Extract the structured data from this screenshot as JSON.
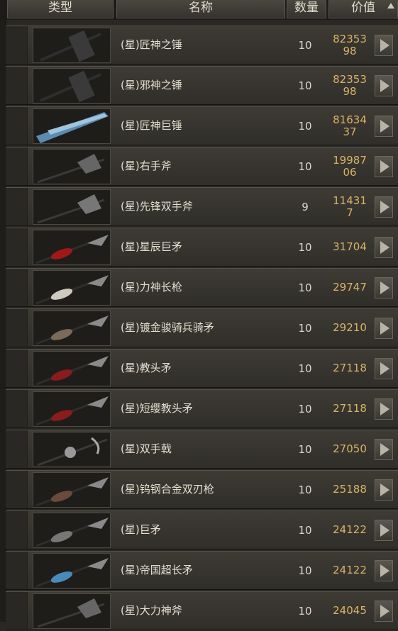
{
  "header": {
    "type_label": "类型",
    "name_label": "名称",
    "qty_label": "数量",
    "value_label": "价值",
    "sort_icon": "triangle-up-icon"
  },
  "colors": {
    "value_text": "#d9b46a",
    "row_bg": "#3a3731"
  },
  "items": [
    {
      "name": "(星)匠神之锤",
      "qty": "10",
      "value_line1": "82353",
      "value_line2": "98",
      "icon": "hammer",
      "accent": "#555"
    },
    {
      "name": "(星)邪神之锤",
      "qty": "10",
      "value_line1": "82353",
      "value_line2": "98",
      "icon": "hammer",
      "accent": "#555"
    },
    {
      "name": "(星)匠神巨锤",
      "qty": "10",
      "value_line1": "81634",
      "value_line2": "37",
      "icon": "blade",
      "accent": "#5a8bb0"
    },
    {
      "name": "(星)右手斧",
      "qty": "10",
      "value_line1": "19987",
      "value_line2": "06",
      "icon": "axe",
      "accent": "#666"
    },
    {
      "name": "(星)先锋双手斧",
      "qty": "9",
      "value_line1": "11431",
      "value_line2": "7",
      "icon": "axe",
      "accent": "#777"
    },
    {
      "name": "(星)星辰巨矛",
      "qty": "10",
      "value_line1": "31704",
      "value_line2": "",
      "icon": "spear",
      "accent": "#a01818"
    },
    {
      "name": "(星)力神长枪",
      "qty": "10",
      "value_line1": "29747",
      "value_line2": "",
      "icon": "spear",
      "accent": "#cfcac0"
    },
    {
      "name": "(星)镀金骏骑兵骑矛",
      "qty": "10",
      "value_line1": "29210",
      "value_line2": "",
      "icon": "spear",
      "accent": "#7a6a5a"
    },
    {
      "name": "(星)教头矛",
      "qty": "10",
      "value_line1": "27118",
      "value_line2": "",
      "icon": "spear",
      "accent": "#8a1c1c"
    },
    {
      "name": "(星)短缨教头矛",
      "qty": "10",
      "value_line1": "27118",
      "value_line2": "",
      "icon": "spear",
      "accent": "#8a1c1c"
    },
    {
      "name": "(星)双手戟",
      "qty": "10",
      "value_line1": "27050",
      "value_line2": "",
      "icon": "halberd",
      "accent": "#999"
    },
    {
      "name": "(星)钨钢合金双刃枪",
      "qty": "10",
      "value_line1": "25188",
      "value_line2": "",
      "icon": "spear",
      "accent": "#6a4a3a"
    },
    {
      "name": "(星)巨矛",
      "qty": "10",
      "value_line1": "24122",
      "value_line2": "",
      "icon": "spear",
      "accent": "#777"
    },
    {
      "name": "(星)帝国超长矛",
      "qty": "10",
      "value_line1": "24122",
      "value_line2": "",
      "icon": "spear",
      "accent": "#4a8ab8"
    },
    {
      "name": "(星)大力神斧",
      "qty": "10",
      "value_line1": "24045",
      "value_line2": "",
      "icon": "axe",
      "accent": "#666"
    }
  ]
}
